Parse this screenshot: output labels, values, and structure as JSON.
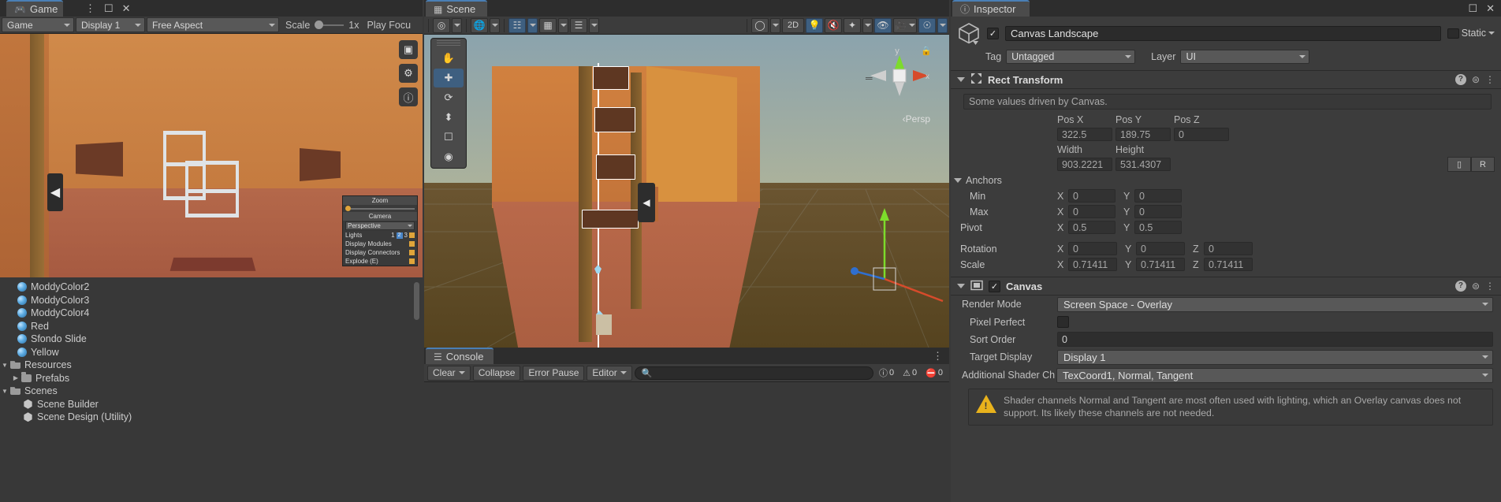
{
  "game_panel": {
    "tab": {
      "label": "Game",
      "icon": "gamepad-icon"
    },
    "toolbar": {
      "mode": "Game",
      "display": "Display 1",
      "aspect": "Free Aspect",
      "scale_label": "Scale",
      "scale_value": "1x",
      "play_focused": "Play Focu"
    },
    "overlay": {
      "zoom_label": "Zoom",
      "camera_label": "Camera",
      "projection": "Perspective",
      "lights_label": "Lights",
      "lights_values": [
        "1",
        "2",
        "3"
      ],
      "display_modules": "Display Modules",
      "display_connectors": "Display Connectors",
      "explode": "Explode (E)"
    },
    "side_icons": [
      "aspect-icon",
      "gear-icon",
      "info-icon"
    ]
  },
  "hierarchy": {
    "items": [
      {
        "label": "ModdyColor2",
        "icon": "material-icon",
        "indent": 2,
        "expander": ""
      },
      {
        "label": "ModdyColor3",
        "icon": "material-icon",
        "indent": 2,
        "expander": ""
      },
      {
        "label": "ModdyColor4",
        "icon": "material-icon",
        "indent": 2,
        "expander": ""
      },
      {
        "label": "Red",
        "icon": "material-icon",
        "indent": 2,
        "expander": ""
      },
      {
        "label": "Sfondo Slide",
        "icon": "material-icon",
        "indent": 2,
        "expander": ""
      },
      {
        "label": "Yellow",
        "icon": "material-icon",
        "indent": 2,
        "expander": ""
      },
      {
        "label": "Resources",
        "icon": "folder-open-icon",
        "indent": 1,
        "expander": "down"
      },
      {
        "label": "Prefabs",
        "icon": "folder-icon",
        "indent": 2,
        "expander": "right"
      },
      {
        "label": "Scenes",
        "icon": "folder-open-icon",
        "indent": 1,
        "expander": "down"
      },
      {
        "label": "Scene Builder",
        "icon": "unity-scene-icon",
        "indent": 2,
        "expander": ""
      },
      {
        "label": "Scene Design (Utility)",
        "icon": "unity-scene-icon",
        "indent": 2,
        "expander": ""
      }
    ]
  },
  "scene_panel": {
    "tab": {
      "label": "Scene",
      "icon": "grid-icon"
    },
    "toolbar": {
      "tool_pivot": "pivot-icon",
      "tool_global": "globe-icon",
      "grid_snap": "grid-snap-icon",
      "snap_increment": "snap-increment-icon",
      "layer_tool": "layers-icon",
      "shading": "shading-sphere-icon",
      "mode_2d": "2D",
      "lighting": "light-bulb-icon",
      "audio": "audio-mute-icon",
      "fx": "effects-icon",
      "hidden": "hidden-eye-icon",
      "camera": "camera-icon",
      "gizmos": "gizmos-icon"
    },
    "overlay_tools": [
      "hand-tool-icon",
      "move-tool-icon",
      "rotate-tool-icon",
      "scale-tool-icon",
      "rect-tool-icon",
      "transform-tool-icon"
    ],
    "gizmo": {
      "y_label": "y",
      "x_label": "x",
      "persp_label": "Persp",
      "lock": "lock-icon"
    }
  },
  "console_panel": {
    "tab": {
      "label": "Console",
      "icon": "console-icon"
    },
    "toolbar": {
      "clear": "Clear",
      "collapse": "Collapse",
      "error_pause": "Error Pause",
      "editor": "Editor",
      "search_placeholder": "",
      "counts": {
        "log": "0",
        "warning": "0",
        "error": "0"
      }
    }
  },
  "inspector": {
    "tab": {
      "label": "Inspector",
      "icon": "info-icon"
    },
    "object": {
      "name": "Canvas Landscape",
      "enabled": true,
      "static_label": "Static",
      "tag_label": "Tag",
      "tag_value": "Untagged",
      "layer_label": "Layer",
      "layer_value": "UI"
    },
    "rect_transform": {
      "title": "Rect Transform",
      "driven_note": "Some values driven by Canvas.",
      "pos_headers": [
        "Pos X",
        "Pos Y",
        "Pos Z"
      ],
      "pos_values": [
        "322.5",
        "189.75",
        "0"
      ],
      "size_headers": [
        "Width",
        "Height"
      ],
      "size_values": [
        "903.2221",
        "531.4307"
      ],
      "blueprint_btn": "blueprint-icon",
      "raw_btn": "R",
      "anchors_label": "Anchors",
      "min_label": "Min",
      "min_x": "0",
      "min_y": "0",
      "max_label": "Max",
      "max_x": "0",
      "max_y": "0",
      "pivot_label": "Pivot",
      "pivot_x": "0.5",
      "pivot_y": "0.5",
      "rotation_label": "Rotation",
      "rotation": [
        "0",
        "0",
        "0"
      ],
      "scale_label": "Scale",
      "scale": [
        "0.71411",
        "0.71411",
        "0.71411"
      ],
      "axis_labels": [
        "X",
        "Y",
        "Z"
      ]
    },
    "canvas": {
      "title": "Canvas",
      "enabled": true,
      "render_mode_label": "Render Mode",
      "render_mode_value": "Screen Space - Overlay",
      "pixel_perfect_label": "Pixel Perfect",
      "pixel_perfect_value": false,
      "sort_order_label": "Sort Order",
      "sort_order_value": "0",
      "target_display_label": "Target Display",
      "target_display_value": "Display 1",
      "shader_channels_label": "Additional Shader Ch",
      "shader_channels_value": "TexCoord1, Normal, Tangent",
      "warning": "Shader channels Normal and Tangent are most often used with lighting, which an Overlay canvas does not support. Its likely these channels are not needed."
    }
  },
  "colors": {
    "accent_blue": "#3e5f80",
    "panel_bg": "#383838",
    "inspector_bg": "#3c3c3c",
    "warning_yellow": "#e8b21c",
    "axis_red": "#d64b2b",
    "axis_green": "#7ddb2b"
  }
}
